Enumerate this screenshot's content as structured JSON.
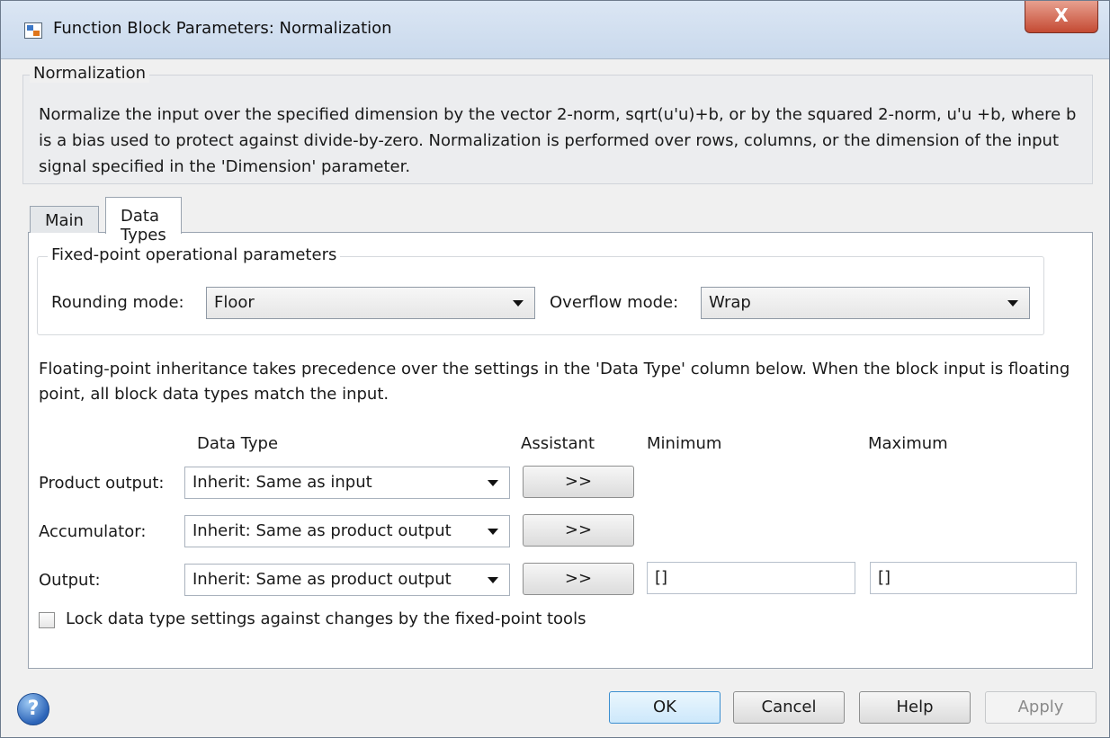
{
  "window": {
    "title": "Function Block Parameters: Normalization",
    "close_label": "X"
  },
  "description": {
    "group_title": "Normalization",
    "text": "Normalize the input over the specified dimension by the vector 2-norm, sqrt(u'u)+b, or by the squared 2-norm, u'u +b, where b is a bias used to protect against divide-by-zero.  Normalization is performed over rows, columns, or the dimension of the input signal specified in the 'Dimension' parameter."
  },
  "tabs": [
    {
      "label": "Main"
    },
    {
      "label": "Data Types"
    }
  ],
  "fixed_point": {
    "group_title": "Fixed-point operational parameters",
    "rounding_label": "Rounding mode:",
    "rounding_value": "Floor",
    "overflow_label": "Overflow mode:",
    "overflow_value": "Wrap"
  },
  "note": "Floating-point inheritance takes precedence over the settings in the 'Data Type' column below. When the block input is floating point, all block data types match the input.",
  "table": {
    "headers": {
      "data_type": "Data Type",
      "assistant": "Assistant",
      "minimum": "Minimum",
      "maximum": "Maximum"
    },
    "rows": [
      {
        "label": "Product output:",
        "data_type": "Inherit: Same as input",
        "assistant": ">>"
      },
      {
        "label": "Accumulator:",
        "data_type": "Inherit: Same as product output",
        "assistant": ">>"
      },
      {
        "label": "Output:",
        "data_type": "Inherit: Same as product output",
        "assistant": ">>",
        "minimum": "[]",
        "maximum": "[]"
      }
    ]
  },
  "lock_checkbox": {
    "label": "Lock data type settings against changes by the fixed-point tools",
    "checked": false
  },
  "buttons": {
    "ok": "OK",
    "cancel": "Cancel",
    "help": "Help",
    "apply": "Apply"
  },
  "help_icon_glyph": "?"
}
